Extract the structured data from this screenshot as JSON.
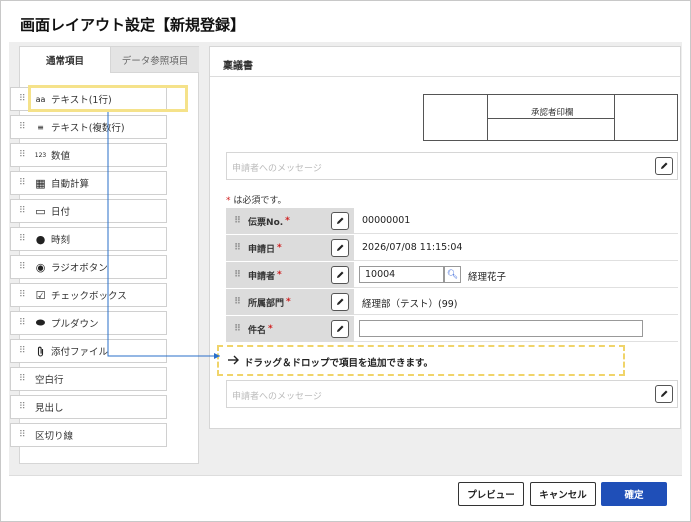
{
  "header": {
    "title": "画面レイアウト設定【新規登録】"
  },
  "palette": {
    "tabs": [
      "通常項目",
      "データ参照項目"
    ],
    "items": [
      {
        "label": "テキスト(1行)",
        "icon": "text-single-icon",
        "glyph": "aa"
      },
      {
        "label": "テキスト(複数行)",
        "icon": "text-multi-icon",
        "glyph": "≡"
      },
      {
        "label": "数値",
        "icon": "number-icon",
        "glyph": "123"
      },
      {
        "label": "自動計算",
        "icon": "calculator-icon",
        "glyph": "▦"
      },
      {
        "label": "日付",
        "icon": "calendar-icon",
        "glyph": "▭"
      },
      {
        "label": "時刻",
        "icon": "clock-icon",
        "glyph": "●"
      },
      {
        "label": "ラジオボタン",
        "icon": "radio-icon",
        "glyph": "◉"
      },
      {
        "label": "チェックボックス",
        "icon": "checkbox-icon",
        "glyph": "☑"
      },
      {
        "label": "プルダウン",
        "icon": "toggle-icon",
        "glyph": "⬬"
      },
      {
        "label": "添付ファイル",
        "icon": "paperclip-icon",
        "glyph": "🖇"
      },
      {
        "label": "空白行",
        "icon": "",
        "glyph": ""
      },
      {
        "label": "見出し",
        "icon": "",
        "glyph": ""
      },
      {
        "label": "区切り線",
        "icon": "",
        "glyph": ""
      }
    ]
  },
  "form": {
    "name": "稟議書",
    "approval_label": "承認者印欄",
    "message_placeholder": "申請者へのメッセージ",
    "required_note_star": "*",
    "required_note": "は必須です。",
    "fields": [
      {
        "label": "伝票No.",
        "required": "*",
        "value": "00000001"
      },
      {
        "label": "申請日",
        "required": "*",
        "value": "2026/07/08 11:15:04"
      },
      {
        "label": "申請者",
        "required": "*",
        "input_value": "10004",
        "value": "経理花子"
      },
      {
        "label": "所属部門",
        "required": "*",
        "value": "経理部（テスト）(99)"
      },
      {
        "label": "件名",
        "required": "*",
        "input_value": ""
      }
    ],
    "drop_hint": "ドラッグ＆ドロップで項目を追加できます。",
    "bottom_message_placeholder": "申請者へのメッセージ"
  },
  "footer": {
    "preview": "プレビュー",
    "cancel": "キャンセル",
    "confirm": "確定"
  },
  "colors": {
    "highlight": "#f5e28a",
    "primary": "#1f4fb8",
    "connector": "#2a6fc9",
    "required": "#d02020"
  }
}
